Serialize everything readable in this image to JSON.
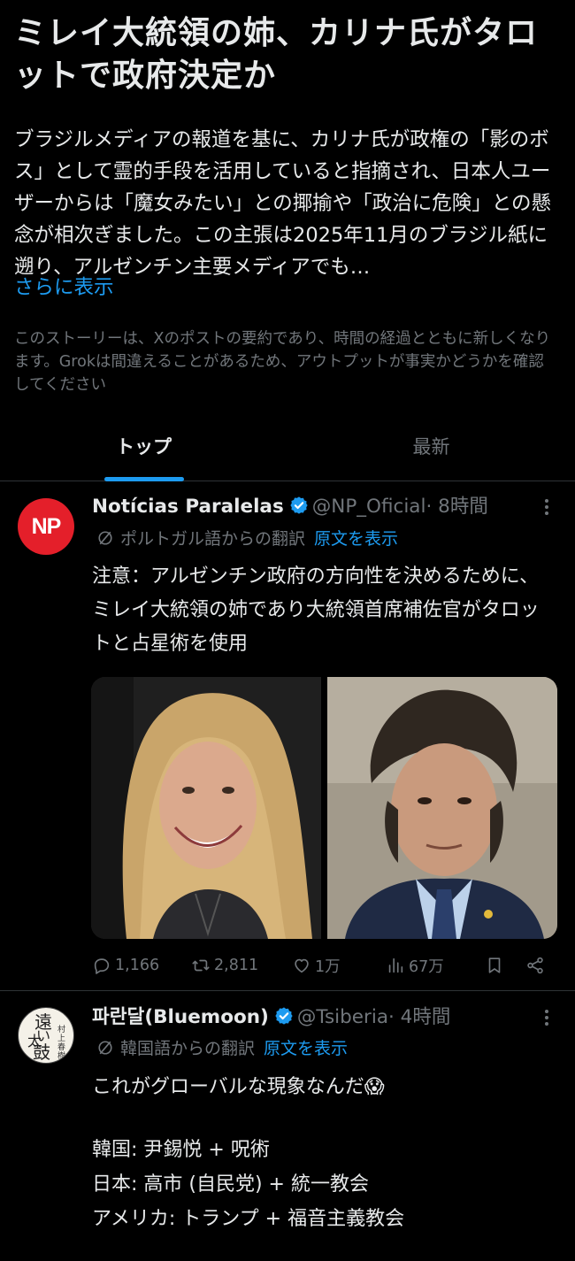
{
  "story": {
    "headline": "ミレイ大統領の姉、カリナ氏がタロットで政府決定か",
    "summary": "ブラジルメディアの報道を基に、カリナ氏が政権の「影のボス」として霊的手段を活用していると指摘され、日本人ユーザーからは「魔女みたい」との揶揄や「政治に危険」との懸念が相次ぎました。この主張は2025年11月のブラジル紙に遡り、アルゼンチン主要メディアでも…",
    "show_more": "さらに表示",
    "disclaimer": "このストーリーは、Xのポストの要約であり、時間の経過とともに新しくなります。Grokは間違えることがあるため、アウトプットが事実かどうかを確認してください"
  },
  "tabs": [
    {
      "label": "トップ",
      "active": true
    },
    {
      "label": "最新",
      "active": false
    }
  ],
  "posts": [
    {
      "avatar_text": "NP",
      "display_name": "Notícias Paralelas",
      "handle": "@NP_Oficial",
      "time": "· 8時間",
      "translated_from": "ポルトガル語からの翻訳",
      "show_original": "原文を表示",
      "text": "注意：アルゼンチン政府の方向性を決めるために、ミレイ大統領の姉であり大統領首席補佐官がタロットと占星術を使用",
      "stats": {
        "replies": "1,166",
        "reposts": "2,811",
        "likes": "1万",
        "views": "67万"
      }
    },
    {
      "avatar_text": [
        "遠",
        "い",
        "太",
        "鼓",
        "村上春樹"
      ],
      "display_name": "파란달(Bluemoon)",
      "handle": "@Tsiberia",
      "time": "· 4時間",
      "translated_from": "韓国語からの翻訳",
      "show_original": "原文を表示",
      "text_line1": "これがグローバルな現象なんだ😱",
      "text_lines": [
        "韓国: 尹錫悦 + 呪術",
        "日本: 高市 (自民党) + 統一教会",
        "アメリカ: トランプ + 福音主義教会"
      ]
    }
  ],
  "colors": {
    "background": "#000000",
    "text": "#e7e9ea",
    "secondary": "#71767b",
    "accent": "#1d9bf0",
    "np_red": "#e41f2a"
  },
  "icons": [
    "verified-badge-icon",
    "more-options-icon",
    "translate-slash-icon",
    "reply-icon",
    "repost-icon",
    "like-icon",
    "views-icon",
    "bookmark-icon",
    "share-icon"
  ]
}
